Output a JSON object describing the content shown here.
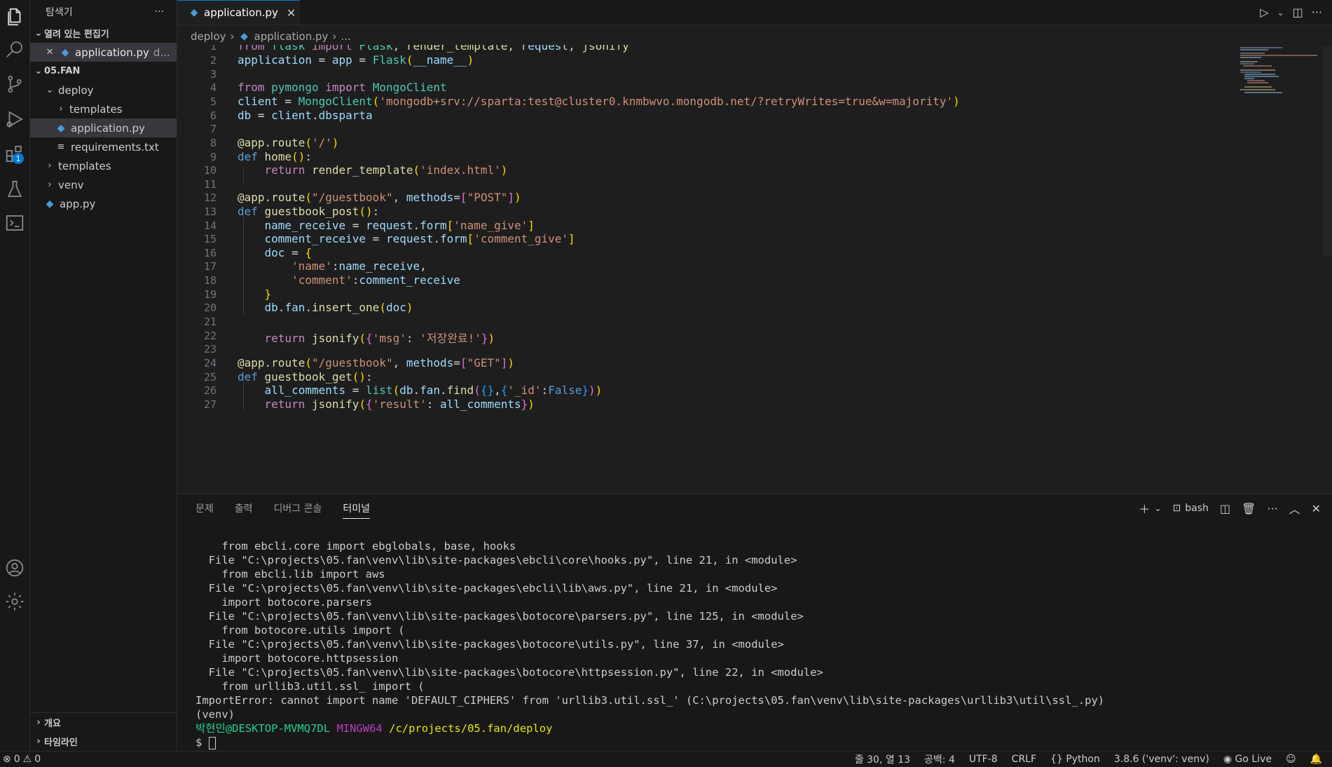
{
  "sidebar": {
    "title": "탐색기",
    "more": "···",
    "open_editors_label": "열려 있는 편집기",
    "open_editor_file": "application.py",
    "open_editor_suffix": "d...",
    "root_label": "05.FAN",
    "tree": [
      {
        "label": "deploy",
        "chev": "⌄",
        "indent": 1
      },
      {
        "label": "templates",
        "chev": "›",
        "indent": 2
      },
      {
        "label": "application.py",
        "icon": "python",
        "indent": 2,
        "selected": true
      },
      {
        "label": "requirements.txt",
        "icon": "text",
        "indent": 2
      },
      {
        "label": "templates",
        "chev": "›",
        "indent": 1
      },
      {
        "label": "venv",
        "chev": "›",
        "indent": 1
      },
      {
        "label": "app.py",
        "icon": "python",
        "indent": 1
      }
    ],
    "outline_label": "개요",
    "timeline_label": "타임라인"
  },
  "activity": {
    "extensions_badge": "1"
  },
  "tab": {
    "label": "application.py",
    "close": "✕"
  },
  "breadcrumb": {
    "folder": "deploy",
    "file": "application.py",
    "tail": "..."
  },
  "editor": {
    "line_numbers": [
      "1",
      "2",
      "3",
      "4",
      "5",
      "6",
      "7",
      "8",
      "9",
      "10",
      "11",
      "12",
      "13",
      "14",
      "15",
      "16",
      "17",
      "18",
      "19",
      "20",
      "21",
      "22",
      "23",
      "24",
      "25",
      "26",
      "27"
    ]
  },
  "panel": {
    "tabs": [
      "문제",
      "출력",
      "디버그 콘솔",
      "터미널"
    ],
    "active_tab": "터미널",
    "shell": "bash",
    "terminal_lines": [
      "    from ebcli.core import ebglobals, base, hooks",
      "  File \"C:\\projects\\05.fan\\venv\\lib\\site-packages\\ebcli\\core\\hooks.py\", line 21, in <module>",
      "    from ebcli.lib import aws",
      "  File \"C:\\projects\\05.fan\\venv\\lib\\site-packages\\ebcli\\lib\\aws.py\", line 21, in <module>",
      "    import botocore.parsers",
      "  File \"C:\\projects\\05.fan\\venv\\lib\\site-packages\\botocore\\parsers.py\", line 125, in <module>",
      "    from botocore.utils import (",
      "  File \"C:\\projects\\05.fan\\venv\\lib\\site-packages\\botocore\\utils.py\", line 37, in <module>",
      "    import botocore.httpsession",
      "  File \"C:\\projects\\05.fan\\venv\\lib\\site-packages\\botocore\\httpsession.py\", line 22, in <module>",
      "    from urllib3.util.ssl_ import (",
      "ImportError: cannot import name 'DEFAULT_CIPHERS' from 'urllib3.util.ssl_' (C:\\projects\\05.fan\\venv\\lib\\site-packages\\urllib3\\util\\ssl_.py)",
      "(venv)"
    ],
    "prompt_user": "박현민",
    "prompt_host": "@DESKTOP-MVMQ7DL",
    "prompt_env": "MINGW64",
    "prompt_path": "/c/projects/05.fan/deploy",
    "prompt_symbol": "$"
  },
  "status": {
    "errors": "0",
    "warnings": "0",
    "position": "줄 30, 열 13",
    "indent": "공백: 4",
    "encoding": "UTF-8",
    "eol": "CRLF",
    "language": "Python",
    "interpreter": "3.8.6 ('venv': venv)",
    "golive": "Go Live"
  },
  "colors": {
    "accent": "#0078d4",
    "background": "#1e1e1e",
    "sidebar": "#181818"
  }
}
